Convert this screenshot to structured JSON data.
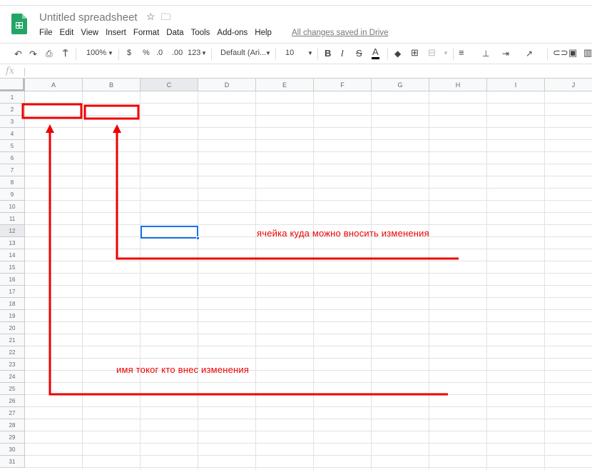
{
  "app": {
    "title": "Untitled spreadsheet",
    "save_status": "All changes saved in Drive"
  },
  "menu": [
    "File",
    "Edit",
    "View",
    "Insert",
    "Format",
    "Data",
    "Tools",
    "Add-ons",
    "Help"
  ],
  "toolbar": {
    "zoom": "100%",
    "currency": "$",
    "percent": "%",
    "dec_less": ".0",
    "dec_more": ".00",
    "format_more": "123",
    "font": "Default (Ari...",
    "font_size": "10",
    "bold": "B",
    "italic": "I",
    "strike": "S",
    "text_color": "A"
  },
  "formula_bar": {
    "label": "fx",
    "value": ""
  },
  "columns": [
    "A",
    "B",
    "C",
    "D",
    "E",
    "F",
    "G",
    "H",
    "I",
    "J"
  ],
  "rows": [
    "1",
    "2",
    "3",
    "4",
    "5",
    "6",
    "7",
    "8",
    "9",
    "10",
    "11",
    "12",
    "13",
    "14",
    "15",
    "16",
    "17",
    "18",
    "19",
    "20",
    "21",
    "22",
    "23",
    "24",
    "25",
    "26",
    "27",
    "28",
    "29",
    "30",
    "31"
  ],
  "selected_cell": "C12",
  "annotations": {
    "color": "#e00000",
    "editable_cell": "ячейка куда можно вносить изменения",
    "editor_name": "имя токог кто внес изменения"
  }
}
